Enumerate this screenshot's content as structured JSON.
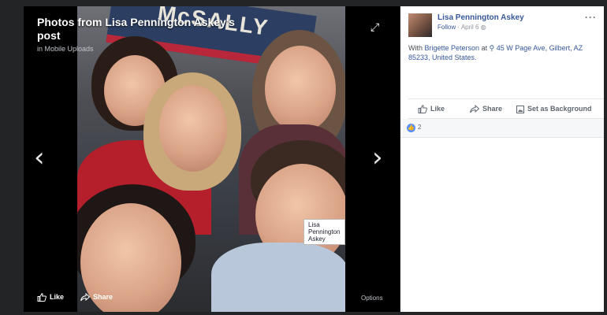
{
  "viewer": {
    "title": "Photos from Lisa Pennington Askey's post",
    "subtitle": "in Mobile Uploads",
    "banner_text": "McSALLY",
    "tag_label": "Lisa Pennington Askey",
    "like_label": "Like",
    "share_label": "Share",
    "options_label": "Options"
  },
  "post": {
    "author": "Lisa Pennington Askey",
    "follow_label": "Follow",
    "date": "April 6",
    "with_prefix": "With ",
    "with_name": "Brigette Peterson",
    "at_word": " at ",
    "location": "45 W Page Ave, Gilbert, AZ 85233, United States.",
    "like_label": "Like",
    "share_label": "Share",
    "background_label": "Set as Background",
    "reaction_count": "2"
  },
  "colors": {
    "link": "#365899",
    "like_blue": "#5890ff",
    "stage": "#000000"
  }
}
